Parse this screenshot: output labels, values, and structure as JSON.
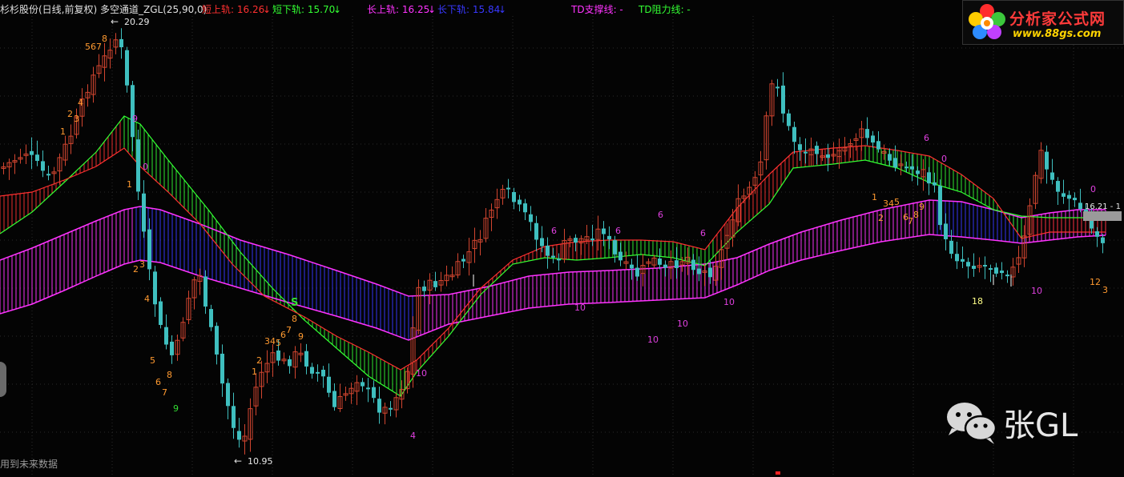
{
  "header": {
    "title": "杉杉股份(日线,前复权) 多空通道_ZGL(25,90,0)",
    "indicators": [
      {
        "label": "短上轨: 16.26",
        "arrow": "↓",
        "color": "#ff3030"
      },
      {
        "label": "短下轨: 15.70",
        "arrow": "↓",
        "color": "#33ff33"
      },
      {
        "label": "长上轨: 16.25",
        "arrow": "↓",
        "color": "#ff33ff"
      },
      {
        "label": "长下轨: 15.84",
        "arrow": "↓",
        "color": "#3838ff"
      },
      {
        "label": "TD支撑线: -",
        "arrow": "",
        "color": "#ff33ff"
      },
      {
        "label": "TD阻力线: -",
        "arrow": "",
        "color": "#33ff33"
      }
    ]
  },
  "logo": {
    "name": "分析家公式网",
    "url": "www.88gs.com"
  },
  "watermark": {
    "text": "张GL",
    "icon": "wechat-icon"
  },
  "footer_note": "用到未来数据",
  "price_labels": {
    "high": "20.29",
    "low": "10.95",
    "last": "16.21 - 1"
  },
  "signal_label": "S",
  "td_labels": [
    {
      "text": "567",
      "c": "o"
    },
    {
      "text": "8",
      "c": "o"
    },
    {
      "text": "4",
      "c": "o"
    },
    {
      "text": "2",
      "c": "o"
    },
    {
      "text": "3",
      "c": "o"
    },
    {
      "text": "1",
      "c": "o"
    },
    {
      "text": "9",
      "c": "m"
    },
    {
      "text": "0",
      "c": "m"
    },
    {
      "text": "1",
      "c": "o"
    },
    {
      "text": "2",
      "c": "o"
    },
    {
      "text": "3",
      "c": "o"
    },
    {
      "text": "4",
      "c": "o"
    },
    {
      "text": "5",
      "c": "o"
    },
    {
      "text": "6",
      "c": "o"
    },
    {
      "text": "7",
      "c": "o"
    },
    {
      "text": "8",
      "c": "o"
    },
    {
      "text": "9",
      "c": "g"
    },
    {
      "text": "1",
      "c": "o"
    },
    {
      "text": "2",
      "c": "o"
    },
    {
      "text": "34",
      "c": "o"
    },
    {
      "text": "5",
      "c": "o"
    },
    {
      "text": "6",
      "c": "o"
    },
    {
      "text": "7",
      "c": "o"
    },
    {
      "text": "8",
      "c": "o"
    },
    {
      "text": "9",
      "c": "o"
    },
    {
      "text": "10",
      "c": "m"
    },
    {
      "text": "4",
      "c": "m"
    },
    {
      "text": "6",
      "c": "m"
    },
    {
      "text": "10",
      "c": "m"
    },
    {
      "text": "6",
      "c": "m"
    },
    {
      "text": "6",
      "c": "m"
    },
    {
      "text": "10",
      "c": "m"
    },
    {
      "text": "10",
      "c": "m"
    },
    {
      "text": "6",
      "c": "m"
    },
    {
      "text": "10",
      "c": "m"
    },
    {
      "text": "6",
      "c": "m"
    },
    {
      "text": "0",
      "c": "m"
    },
    {
      "text": "1",
      "c": "o"
    },
    {
      "text": "2",
      "c": "o"
    },
    {
      "text": "34",
      "c": "o"
    },
    {
      "text": "5",
      "c": "o"
    },
    {
      "text": "6",
      "c": "o"
    },
    {
      "text": "7",
      "c": "o"
    },
    {
      "text": "8",
      "c": "o"
    },
    {
      "text": "9",
      "c": "o"
    },
    {
      "text": "18",
      "c": "y"
    },
    {
      "text": "10",
      "c": "m"
    },
    {
      "text": "0",
      "c": "m"
    },
    {
      "text": "12",
      "c": "o"
    },
    {
      "text": "3",
      "c": "o"
    }
  ],
  "colors": {
    "bg": "#040404",
    "grid": "#2a2a2a",
    "short_upper": "#ff3030",
    "short_lower": "#33ff33",
    "long_upper": "#ff33ff",
    "long_lower": "#3838ff",
    "candle_up": "#d2452f",
    "candle_down": "#3fbfbf",
    "td_orange": "#ff9a30",
    "td_magenta": "#e040e0",
    "td_green": "#33dd33",
    "td_yellow": "#ffff88"
  }
}
